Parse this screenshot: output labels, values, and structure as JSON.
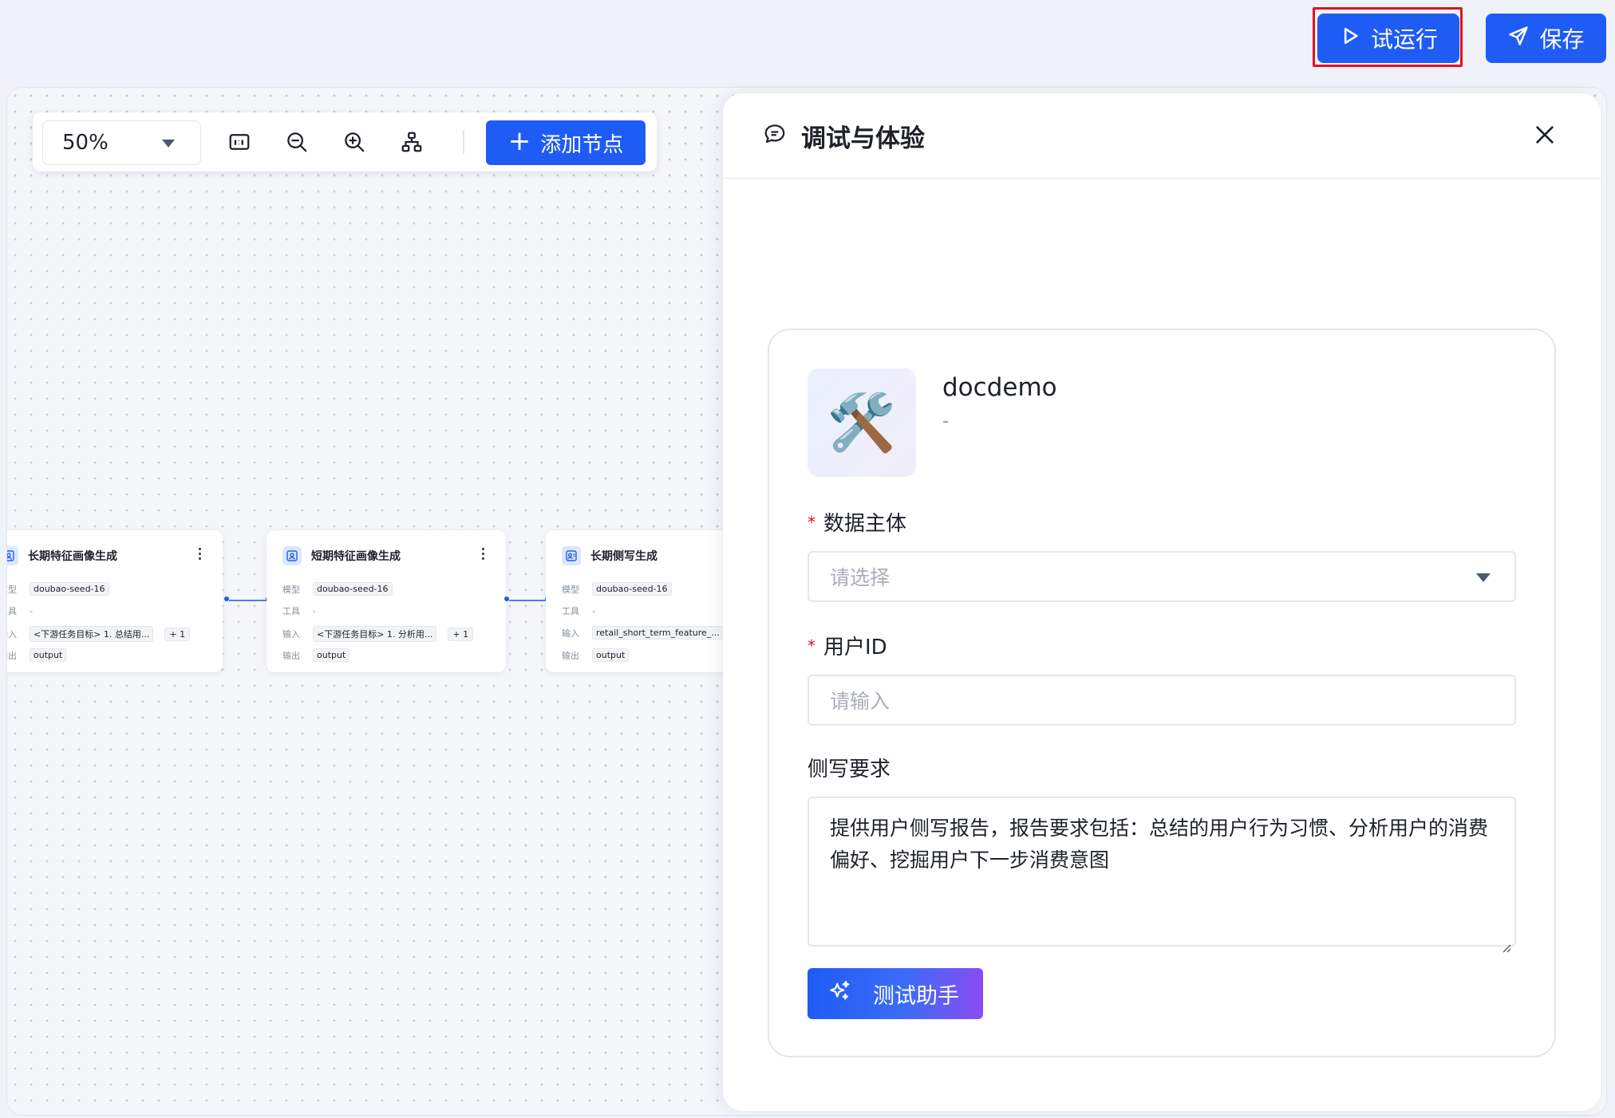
{
  "topbar": {
    "run_label": "试运行",
    "save_label": "保存"
  },
  "toolbar": {
    "zoom_value": "50%",
    "add_node_label": "添加节点",
    "icons": [
      "fit-view-icon",
      "zoom-out-icon",
      "zoom-in-icon",
      "auto-layout-icon"
    ]
  },
  "nodes": [
    {
      "title": "长期特征画像生成",
      "rows": [
        {
          "key": "模型",
          "value": "doubao-seed-16"
        },
        {
          "key": "工具",
          "value": "-"
        },
        {
          "key": "输入",
          "value": "<下游任务目标> 1. 总结用...",
          "extra": "+ 1"
        },
        {
          "key": "输出",
          "value": "output"
        }
      ]
    },
    {
      "title": "短期特征画像生成",
      "rows": [
        {
          "key": "模型",
          "value": "doubao-seed-16"
        },
        {
          "key": "工具",
          "value": "-"
        },
        {
          "key": "输入",
          "value": "<下游任务目标> 1. 分析用...",
          "extra": "+ 1"
        },
        {
          "key": "输出",
          "value": "output"
        }
      ]
    },
    {
      "title": "长期侧写生成",
      "rows": [
        {
          "key": "模型",
          "value": "doubao-seed-16"
        },
        {
          "key": "工具",
          "value": "-"
        },
        {
          "key": "输入",
          "value": "retail_short_term_feature_..."
        },
        {
          "key": "输出",
          "value": "output"
        }
      ]
    }
  ],
  "panel": {
    "title": "调试与体验",
    "app": {
      "icon": "🛠️",
      "name": "docdemo",
      "description": "-"
    },
    "fields": {
      "subject_label": "数据主体",
      "subject_placeholder": "请选择",
      "user_id_label": "用户ID",
      "user_id_placeholder": "请输入",
      "profile_label": "侧写要求",
      "profile_value": "提供用户侧写报告，报告要求包括：总结的用户行为习惯、分析用户的消费偏好、挖掘用户下一步消费意图",
      "required_mark": "*"
    },
    "assist_label": "测试助手"
  },
  "colors": {
    "primary": "#1f5cf5",
    "highlight": "#e5111c",
    "gradient_end": "#8a4cf2"
  }
}
